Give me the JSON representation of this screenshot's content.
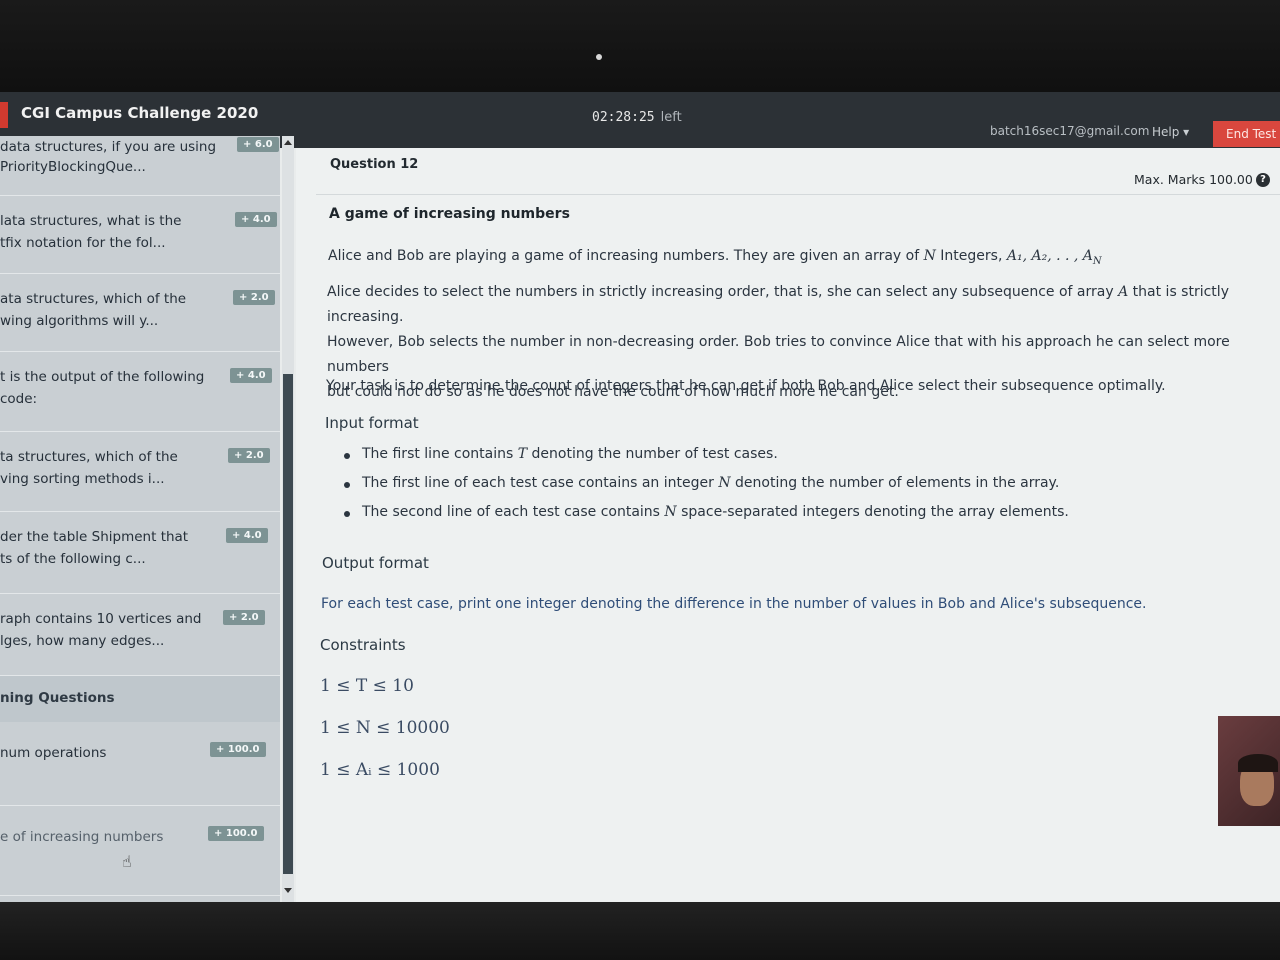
{
  "header": {
    "app_title": "CGI Campus Challenge 2020",
    "timer": "02:28:25",
    "timer_suffix": "left",
    "email": "batch16sec17@gmail.com",
    "help": "Help ▾",
    "end_test": "End Test"
  },
  "sidebar": {
    "questions": [
      {
        "line1": "data structures, if you are using",
        "line2": "PriorityBlockingQue...",
        "badge": "+ 6.0"
      },
      {
        "line1": "lata structures, what is the",
        "line2": "tfix notation for the fol...",
        "badge": "+ 4.0"
      },
      {
        "line1": "ata structures, which of the",
        "line2": "wing algorithms will y...",
        "badge": "+ 2.0"
      },
      {
        "line1": "t is the output of the following",
        "line2": "code:",
        "badge": "+ 4.0"
      },
      {
        "line1": "ta structures, which of the",
        "line2": "ving sorting methods i...",
        "badge": "+ 2.0"
      },
      {
        "line1": "der the table Shipment that",
        "line2": "ts of the following c...",
        "badge": "+ 4.0"
      },
      {
        "line1": "raph contains 10 vertices and",
        "line2": "lges, how many edges...",
        "badge": "+ 2.0"
      }
    ],
    "section_title": "ning Questions",
    "coding": [
      {
        "label": "num operations",
        "badge": "+ 100.0"
      },
      {
        "label": "e of increasing numbers",
        "badge": "+ 100.0"
      }
    ]
  },
  "main": {
    "question_label": "Question  12",
    "max_marks": "Max. Marks 100.00",
    "title": "A game of increasing numbers",
    "intro_text": "Alice and Bob are playing a game of increasing numbers. They are given an array of ",
    "intro_math": "N",
    "intro_text2": " Integers, ",
    "intro_math2": "A₁, A₂, . . , A",
    "intro_math2_sub": "N",
    "para2_line1a": "Alice decides to select the numbers in strictly increasing order, that is, she can select any subsequence of array ",
    "para2_math": "A",
    "para2_line1b": " that is strictly increasing.",
    "para2_line2": "However, Bob selects the number in non-decreasing order. Bob tries to convince Alice that with his approach he can select more numbers",
    "para2_line3": "but could not do so as he does not have the count of how much more he can get.",
    "task": "Your task is to determine the count of integers that he can get if both Bob and Alice select their subsequence optimally.",
    "input_title": "Input format",
    "bullets": [
      {
        "a": "The first line contains ",
        "m": "T",
        "b": " denoting the number of test cases."
      },
      {
        "a": "The first line of each test case contains an integer ",
        "m": "N",
        "b": " denoting the number of elements in the array."
      },
      {
        "a": "The second line of each test case contains ",
        "m": "N",
        "b": " space-separated integers denoting the array elements."
      }
    ],
    "output_title": "Output format",
    "output_text": "For each test case, print one integer denoting the difference in the number of values in Bob and Alice's subsequence.",
    "constraints_title": "Constraints",
    "constraints": [
      "1 ≤ T ≤ 10",
      "1 ≤ N ≤ 10000",
      "1 ≤ Aᵢ ≤ 1000"
    ]
  }
}
